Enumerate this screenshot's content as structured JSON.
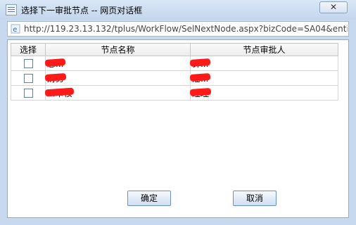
{
  "window": {
    "title": "选择下一审批节点 -- 网页对话框",
    "close_label": "✕"
  },
  "address": {
    "url": "http://119.23.13.132/tplus/WorkFlow/SelNextNode.aspx?bizCode=SA04&entity"
  },
  "table": {
    "headers": [
      "选择",
      "节点名称",
      "节点审批人"
    ],
    "rows": [
      {
        "node_name": "总...",
        "approver": "钟..."
      },
      {
        "node_name": "财务",
        "approver": "潘..."
      },
      {
        "node_name": "...审核",
        "approver": "经理"
      }
    ]
  },
  "buttons": {
    "ok_label": "确定",
    "cancel_label": "取消"
  }
}
